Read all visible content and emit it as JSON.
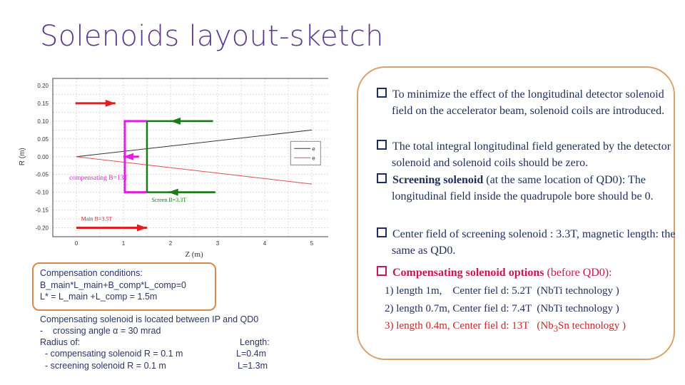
{
  "title": "Solenoids layout-sketch",
  "chart_data": {
    "type": "line",
    "xlabel": "Z (m)",
    "ylabel": "R (m)",
    "xlim": [
      -0.5,
      5.5
    ],
    "ylim": [
      -0.225,
      0.22
    ],
    "xticks": [
      "0",
      "1",
      "2",
      "3",
      "4",
      "5"
    ],
    "yticks": [
      "0.20",
      "0.15",
      "0.10",
      "0.05",
      "0.00",
      "-0.05",
      "-0.10",
      "-0.15",
      "-0.20"
    ],
    "grid": true,
    "legend_placement": "right",
    "series": [
      {
        "name": "e-",
        "color": "#333333",
        "x": [
          0,
          5
        ],
        "y": [
          0,
          0.075
        ]
      },
      {
        "name": "e+",
        "color": "#e05050",
        "x": [
          0,
          5
        ],
        "y": [
          0,
          -0.077
        ]
      }
    ],
    "annotations": [
      {
        "text": "compensating B=13T",
        "color": "#e020e0"
      },
      {
        "text": "Screen B=3.3T",
        "color": "#1a7a1a"
      },
      {
        "text": "Main B=3.5T",
        "color": "#d02020"
      }
    ],
    "shapes": {
      "compensating": {
        "z": [
          1.03,
          1.5
        ],
        "r": [
          -0.1,
          0.1
        ],
        "color": "#e020e0"
      },
      "screen": {
        "z": [
          1.5,
          2.95
        ],
        "r": [
          -0.1,
          0.1
        ],
        "color": "#1a7a1a"
      }
    }
  },
  "left": {
    "conditions": [
      "Compensation conditions:",
      "B_main*L_main+B_comp*L_comp=0",
      "L* = L_main +L_comp = 1.5m"
    ],
    "notes": [
      "Compensating solenoid is located between IP and QD0",
      "-    crossing angle α = 30 mrad",
      "Radius of:",
      "  - compensating solenoid R = 0.1 m",
      "  - screening solenoid R = 0.1 m"
    ],
    "length_label": "Length:",
    "len1": "L=0.4m",
    "len2": "L=1.3m"
  },
  "bullets": [
    "To minimize the effect of the longitudinal detector solenoid field on the accelerator beam, solenoid coils are introduced.",
    "The total integral longitudinal field generated by the detector solenoid and solenoid coils should be zero.",
    "Center field of screening solenoid : 3.3T, magnetic length: the same as QD0."
  ],
  "screening": {
    "bold": "Screening solenoid",
    "rest": " (at the same location of QD0): The longitudinal field inside the quadrupole bore should be 0."
  },
  "options": {
    "heading": "Compensating solenoid options",
    "heading_rest": " (before QD0):",
    "items": [
      "1) length 1m,    Center fiel d: 5.2T  (NbTi technology )",
      "2) length 0.7m, Center fiel d: 7.4T  (NbTi technology )"
    ],
    "item3a": "3) length 0.4m, Center fiel d: 13T   (Nb",
    "item3sub": "3",
    "item3b": "Sn technology )"
  }
}
